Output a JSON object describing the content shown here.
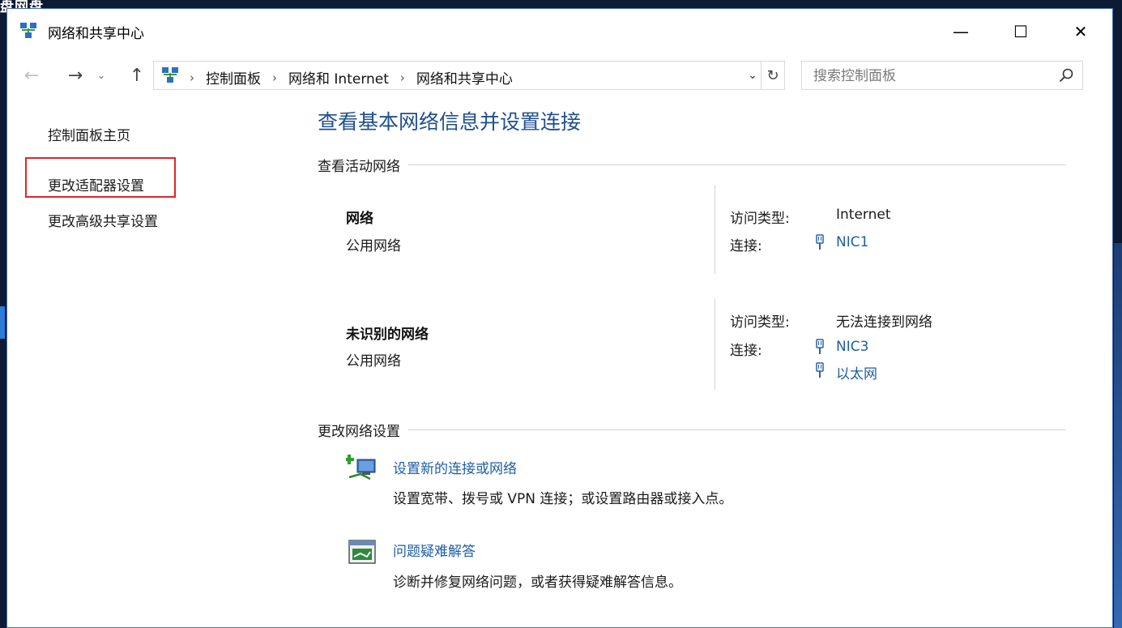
{
  "desktop": {
    "label": "盘网盘"
  },
  "window": {
    "title": "网络和共享中心",
    "controls": {
      "minimize": "—",
      "maximize": "☐",
      "close": "✕"
    }
  },
  "nav": {
    "back": "←",
    "forward": "→",
    "recent": "⌄",
    "up": "↑",
    "breadcrumbs": [
      "控制面板",
      "网络和 Internet",
      "网络和共享中心"
    ],
    "separator": "›",
    "dropdown": "⌄",
    "refresh": "↻"
  },
  "search": {
    "placeholder": "搜索控制面板",
    "value": ""
  },
  "sidebar": {
    "home": "控制面板主页",
    "adapter": "更改适配器设置",
    "sharing": "更改高级共享设置"
  },
  "main": {
    "title": "查看基本网络信息并设置连接",
    "active_section": "查看活动网络",
    "networks": [
      {
        "name": "网络",
        "type": "公用网络",
        "access_label": "访问类型:",
        "access_value": "Internet",
        "connection_label": "连接:",
        "connections": [
          "NIC1"
        ]
      },
      {
        "name": "未识别的网络",
        "type": "公用网络",
        "access_label": "访问类型:",
        "access_value": "无法连接到网络",
        "connection_label": "连接:",
        "connections": [
          "NIC3",
          "以太网"
        ]
      }
    ],
    "change_section": "更改网络设置",
    "tasks": [
      {
        "title": "设置新的连接或网络",
        "desc": "设置宽带、拨号或 VPN 连接；或设置路由器或接入点。",
        "icon": "new-connection-icon"
      },
      {
        "title": "问题疑难解答",
        "desc": "诊断并修复网络问题，或者获得疑难解答信息。",
        "icon": "troubleshoot-icon"
      }
    ]
  },
  "colors": {
    "link": "#1e5ea8",
    "title": "#1e4f8f",
    "highlight": "#e0242b"
  }
}
